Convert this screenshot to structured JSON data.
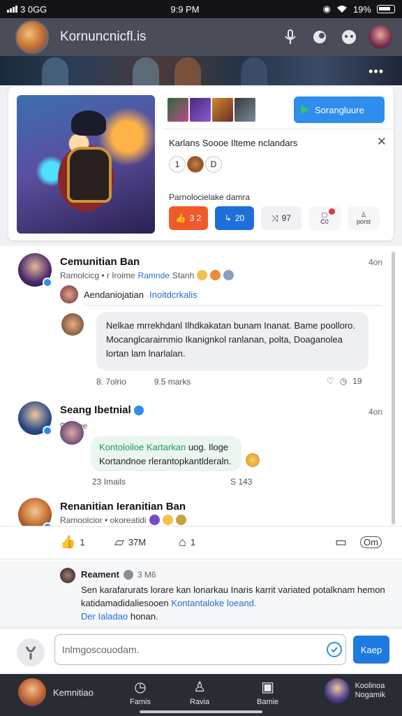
{
  "status_bar": {
    "carrier": "3 0GG",
    "time": "9:9 PM",
    "battery": "19%"
  },
  "header": {
    "title": "Kornuncnicfl.is",
    "icons": [
      "mic-icon",
      "shield-icon",
      "gamepad-icon"
    ]
  },
  "top_card": {
    "primary_button": "Sorangluure",
    "info_title": "Karlans Soooe Ilteme nclandars",
    "counter": [
      "1",
      "0",
      "D"
    ],
    "info_subtitle": "Parnolocielake damra",
    "actions": {
      "orange": "3 2",
      "blue": "20",
      "light": "97",
      "badge_label": "C0",
      "profile_label": "porst"
    }
  },
  "comments": [
    {
      "name": "Cemunitian Ban",
      "time": "4on",
      "meta_prefix": "Ramolcicg • r Iroime",
      "meta_link": "Ramnde",
      "meta_suffix": "Stanh",
      "reply_name": "Aendaniojatian",
      "reply_link": "Inoitdcrkalis",
      "bubble": "Nelkae mrrekhdanl Ilhdkakatan bunam Inanat. Bame poolloro. Mocanglcarairnmio Ikanignkol ranlanan, polta,  Doaganolea lortan lam lnarlalan.",
      "stat_left": "8. 7olrio",
      "stat_right": "9.5 marks",
      "action_right": "19"
    },
    {
      "name": "Seang Ibetnial",
      "time": "4on",
      "meta": "90 Iime",
      "bubble_green": "Kontoloiloe Kartarkan",
      "bubble_rest": "uog. Iloge Kortandnoe rlerantopkantlderaln.",
      "stat_left": "23 Imails",
      "stat_right": "S 143"
    },
    {
      "name": "Renanitian Ieranitian Ban",
      "meta": "Ramoolcior • okoreatidi"
    }
  ],
  "react_bar": {
    "like": "1",
    "comment": "37M",
    "share": "1",
    "right": "Om"
  },
  "bottom_comment": {
    "name": "Reament",
    "time": "3 M6",
    "text_1": "Sen karafarurats lorare kan lonarkau Inaris karrit variated potalknam hemon katidamadidaliesooen ",
    "link_1": "Kontantaloke loeand.",
    "link_2": "Der Ialadao",
    "text_2": " honan."
  },
  "composer": {
    "placeholder": "Inlmgoscouodam.",
    "send_label": "Kaep"
  },
  "bottom_nav": {
    "user_name": "Kemnitiao",
    "items": [
      "Famis",
      "Ravia",
      "Bamie"
    ],
    "right_line_1": "Koolinoa",
    "right_line_2": "Nogamik"
  },
  "colors": {
    "accent": "#2e8ded",
    "orange": "#f05a2a",
    "blue": "#1f6fd9",
    "header": "#4a4d57",
    "nav": "#2a2c33"
  }
}
